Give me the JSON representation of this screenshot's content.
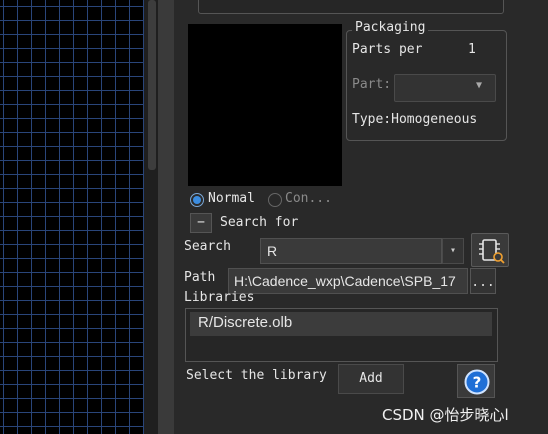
{
  "packaging": {
    "group_title": "Packaging",
    "parts_per_label": "Parts per",
    "parts_per_value": "1",
    "part_label": "Part:",
    "type_label": "Type:Homogeneous"
  },
  "view": {
    "normal_label": "Normal",
    "convert_label": "Con..."
  },
  "search": {
    "collapse_symbol": "−",
    "search_for_label": "Search for",
    "search_label": "Search",
    "search_value": "R",
    "search_dropdown_icon": "▾",
    "search_part_icon": "part-search-icon",
    "path_label": "Path",
    "path_value": "H:\\Cadence_wxp\\Cadence\\SPB_17",
    "browse_label": "...",
    "libraries_label": "Libraries",
    "library_items": [
      "R/Discrete.olb"
    ],
    "select_library_text": "Select the library",
    "add_label": "Add",
    "help_icon": "help-icon"
  },
  "watermark": "CSDN @怡步晓心l",
  "colors": {
    "grid_line": "#29457a",
    "radio_selected": "#3c8de0",
    "help_blue": "#1f6fd6"
  }
}
